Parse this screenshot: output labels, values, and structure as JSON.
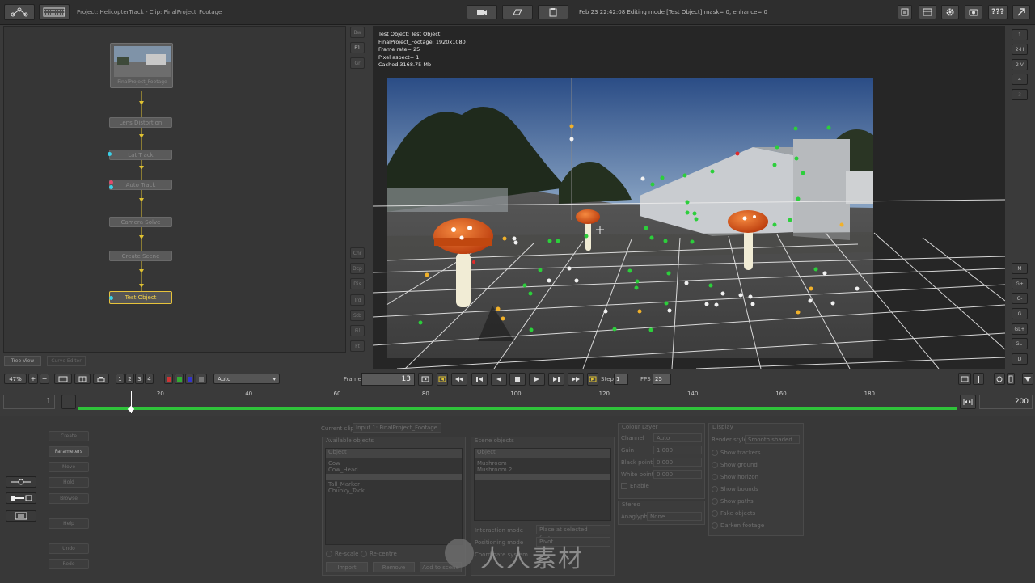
{
  "header": {
    "title": "Project: HelicopterTrack - Clip: FinalProject_Footage",
    "status": "Feb 23 22:42:08 Editing mode [Test Object] mask= 0, enhance= 0",
    "help_label": "???"
  },
  "graph": {
    "thumb_label": "FinalProject_Footage",
    "nodes": [
      "Lens Distortion",
      "Lat Track",
      "Auto Track",
      "Camera Solve",
      "Create Scene"
    ],
    "selected_node": "Test Object",
    "tabs": [
      "Tree View",
      "Curve Editor"
    ],
    "side_tools": [
      "Cnr",
      "Dcp",
      "Dis",
      "Trd",
      "Stb",
      "Fil",
      "Ft"
    ],
    "top_tools": [
      "Bw",
      "P1",
      "Gr"
    ]
  },
  "viewer": {
    "info": [
      "Test Object: Test Object",
      "FinalProject_Footage: 1920x1080",
      "Frame rate= 25",
      "Pixel aspect= 1",
      "Cached 3168.75 Mb"
    ]
  },
  "right_toolbar": {
    "top": [
      "1",
      "2-H",
      "2-V",
      "4",
      "3"
    ],
    "bottom": [
      "M",
      "G+",
      "G-",
      "G",
      "GL+",
      "GL-",
      "D"
    ]
  },
  "transport": {
    "zoom": "47%",
    "views": [
      "1",
      "2",
      "3",
      "4"
    ],
    "mode": "Auto",
    "frame_label": "Frame",
    "frame_value": "13",
    "step_label": "Step",
    "step_value": "1",
    "fps_label": "FPS",
    "fps_value": "25"
  },
  "timeline": {
    "start": "1",
    "end": "200",
    "ticks": [
      "20",
      "40",
      "60",
      "80",
      "100",
      "120",
      "140",
      "160",
      "180"
    ],
    "current_frame": 13,
    "range_start": 1,
    "range_end": 200
  },
  "parameters": {
    "side_buttons": [
      "Create",
      "Parameters",
      "Move",
      "Hold",
      "Browse",
      "Help",
      "Undo",
      "Redo"
    ],
    "current_clip_label": "Current clip",
    "current_clip_value": "Input 1: FinalProject_Footage",
    "available_label": "Available objects",
    "available_header": "Object",
    "available_items": [
      "Cow",
      "Cow_Head",
      "",
      "Tall_Marker",
      "Chunky_Tack"
    ],
    "scene_label": "Scene objects",
    "scene_header": "Object",
    "scene_items": [
      "Mushroom",
      "Mushroom 2",
      ""
    ],
    "rescale_label": "Re-scale",
    "recentre_label": "Re-centre",
    "buttons": [
      "Import",
      "Remove",
      "Add to scene"
    ],
    "interaction_label": "Interaction mode",
    "interaction_value": "Place at selected feature",
    "positioning_label": "Positioning mode",
    "positioning_value": "Pivot",
    "coordinate_label": "Coordinate system",
    "colour_layer_label": "Colour Layer",
    "channel_label": "Channel",
    "channel_value": "Auto",
    "gain_label": "Gain",
    "gain_value": "1.000",
    "black_label": "Black point",
    "black_value": "0.000",
    "white_label": "White point",
    "white_value": "0.000",
    "enable_label": "Enable",
    "stereo_label": "Stereo",
    "anaglyph_label": "Anaglyph",
    "anaglyph_value": "None",
    "display_label": "Display",
    "render_label": "Render style",
    "render_value": "Smooth shaded",
    "display_opts": [
      "Show trackers",
      "Show ground",
      "Show horizon",
      "Show bounds",
      "Show paths",
      "Fake objects",
      "Darken footage"
    ]
  },
  "watermark": "人人素材"
}
